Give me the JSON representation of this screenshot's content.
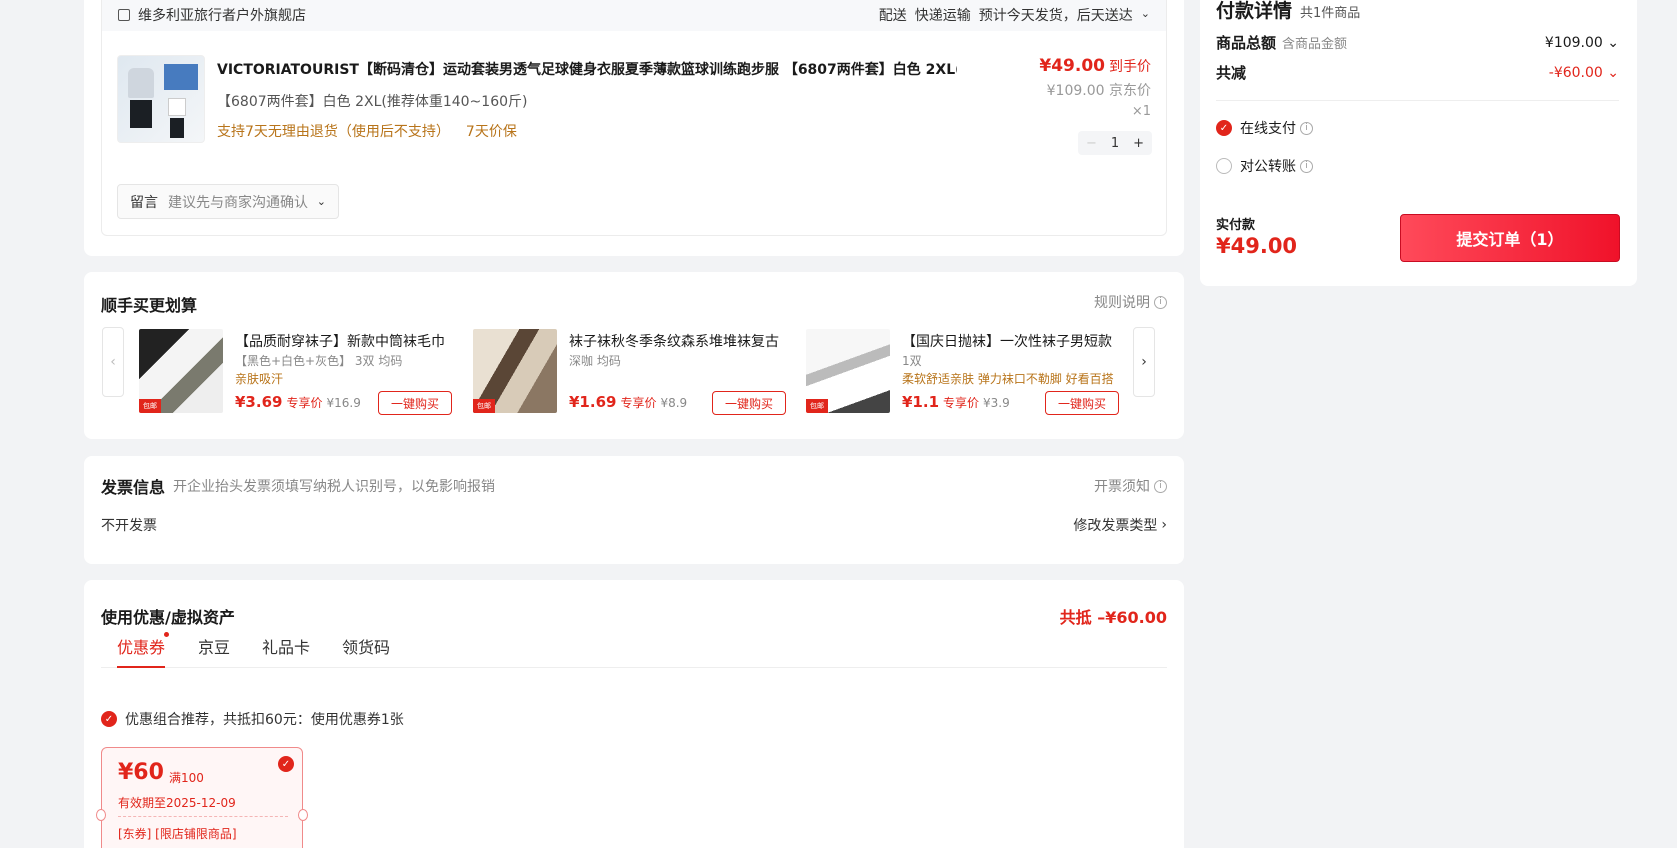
{
  "store": {
    "name": "维多利亚旅行者户外旗舰店",
    "delivery_label": "配送",
    "delivery_method": "快递运输",
    "delivery_time": "预计今天发货，后天送达"
  },
  "product": {
    "title": "VICTORIATOURIST【断码清仓】运动套装男透气足球健身衣服夏季薄款篮球训练跑步服 【6807两件套】白色 2XL(…",
    "spec": "【6807两件套】白色  2XL(推荐体重140~160斤)",
    "service_1": "支持7天无理由退货（使用后不支持）",
    "service_2": "7天价保",
    "price_now": "¥49.00",
    "price_now_label": "到手价",
    "price_jd": "¥109.00",
    "price_jd_label": "京东价",
    "qty_text": "×1",
    "qty": "1",
    "minus": "−",
    "plus": "+"
  },
  "memo": {
    "label": "留言",
    "placeholder": "建议先与商家沟通确认"
  },
  "addon": {
    "title": "顺手买更划算",
    "rules": "规则说明",
    "items": [
      {
        "name": "【品质耐穿袜子】新款中筒袜毛巾",
        "spec": "【黑色+白色+灰色】 3双  均码",
        "feat": "亲肤吸汗",
        "price": "¥3.69",
        "price_label": "专享价",
        "orig": "¥16.9",
        "buy": "一键购买",
        "tag": "包邮"
      },
      {
        "name": "袜子袜秋冬季条纹森系堆堆袜复古",
        "spec": "深咖  均码",
        "feat": "",
        "price": "¥1.69",
        "price_label": "专享价",
        "orig": "¥8.9",
        "buy": "一键购买",
        "tag": "包邮"
      },
      {
        "name": "【国庆日抛袜】一次性袜子男短款",
        "spec": "1双",
        "feat": "柔软舒适亲肤  弹力袜口不勒脚  好看百搭",
        "price": "¥1.1",
        "price_label": "专享价",
        "orig": "¥3.9",
        "buy": "一键购买",
        "tag": "包邮"
      }
    ]
  },
  "invoice": {
    "title": "发票信息",
    "hint": "开企业抬头发票须填写纳税人识别号，以免影响报销",
    "notice": "开票须知",
    "value": "不开发票",
    "change": "修改发票类型"
  },
  "coupon": {
    "title": "使用优惠/虚拟资产",
    "total": "共抵 –¥60.00",
    "tabs": [
      "优惠券",
      "京豆",
      "礼品卡",
      "领货码"
    ],
    "recommend": "优惠组合推荐，共抵扣60元：使用优惠券1张",
    "ticket": {
      "amount": "¥60",
      "condition": "满100",
      "valid": "有效期至2025-12-09",
      "scope": "[东券] [限店铺限商品]"
    }
  },
  "payment": {
    "title": "付款详情",
    "count": "共1件商品",
    "total_label": "商品总额",
    "total_sub": "含商品金额",
    "total_value": "¥109.00",
    "discount_label": "共减",
    "discount_value": "-¥60.00",
    "method_online": "在线支付",
    "method_transfer": "对公转账",
    "pay_label": "实付款",
    "pay_value": "¥49.00",
    "submit": "提交订单（1）"
  },
  "colors": {
    "accent": "#e1251b",
    "service": "#b8741a",
    "background": "#f2f3f5"
  }
}
